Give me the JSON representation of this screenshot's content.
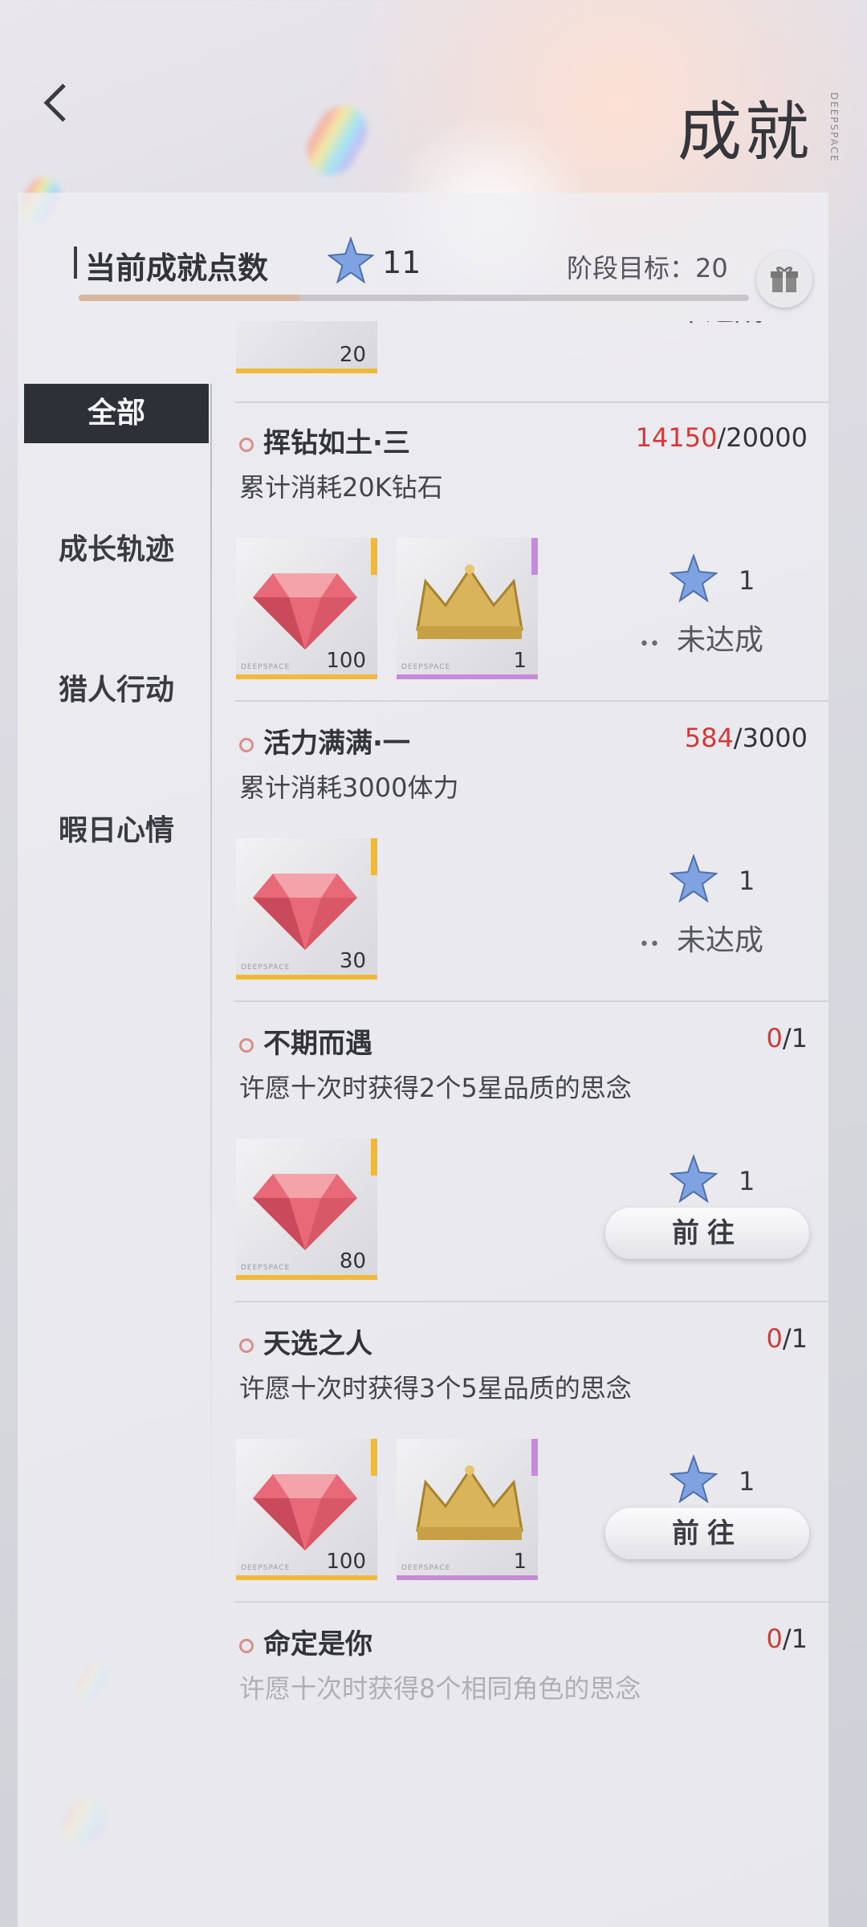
{
  "header": {
    "title": "成就",
    "brand_text": "DEEPSPACE"
  },
  "points": {
    "label": "当前成就点数",
    "value": "11",
    "goal_label": "阶段目标：20",
    "progress_fraction": 0.33
  },
  "sidebar": {
    "items": [
      {
        "label": "全部",
        "active": true
      },
      {
        "label": "成长轨迹",
        "active": false
      },
      {
        "label": "猎人行动",
        "active": false
      },
      {
        "label": "暇日心情",
        "active": false
      }
    ]
  },
  "top_partial": {
    "reward_qty": "20",
    "status": "未达成"
  },
  "achievements": [
    {
      "title": "挥钻如土·三",
      "progress_current": "14150",
      "progress_total": "/20000",
      "desc": "累计消耗20K钻石",
      "rewards": [
        {
          "icon": "gem-icon",
          "qty": "100",
          "rarity": "gold"
        },
        {
          "icon": "crown-icon",
          "qty": "1",
          "rarity": "purple"
        }
      ],
      "star_value": "1",
      "status": "未达成"
    },
    {
      "title": "活力满满·一",
      "progress_current": "584",
      "progress_total": "/3000",
      "desc": "累计消耗3000体力",
      "rewards": [
        {
          "icon": "gem-icon",
          "qty": "30",
          "rarity": "gold"
        }
      ],
      "star_value": "1",
      "status": "未达成"
    },
    {
      "title": "不期而遇",
      "progress_current": "0",
      "progress_total": "/1",
      "desc": "许愿十次时获得2个5星品质的思念",
      "rewards": [
        {
          "icon": "gem-icon",
          "qty": "80",
          "rarity": "gold"
        }
      ],
      "star_value": "1",
      "button": "前往"
    },
    {
      "title": "天选之人",
      "progress_current": "0",
      "progress_total": "/1",
      "desc": "许愿十次时获得3个5星品质的思念",
      "rewards": [
        {
          "icon": "gem-icon",
          "qty": "100",
          "rarity": "gold"
        },
        {
          "icon": "crown-icon",
          "qty": "1",
          "rarity": "purple"
        }
      ],
      "star_value": "1",
      "button": "前往"
    },
    {
      "title": "命定是你",
      "progress_current": "0",
      "progress_total": "/1",
      "desc": "许愿十次时获得8个相同角色的思念"
    }
  ],
  "colors": {
    "gold": "#f1b93a",
    "purple": "#c58ad8",
    "accent_red": "#d23a3a",
    "sidebar_active": "#2e3038"
  }
}
